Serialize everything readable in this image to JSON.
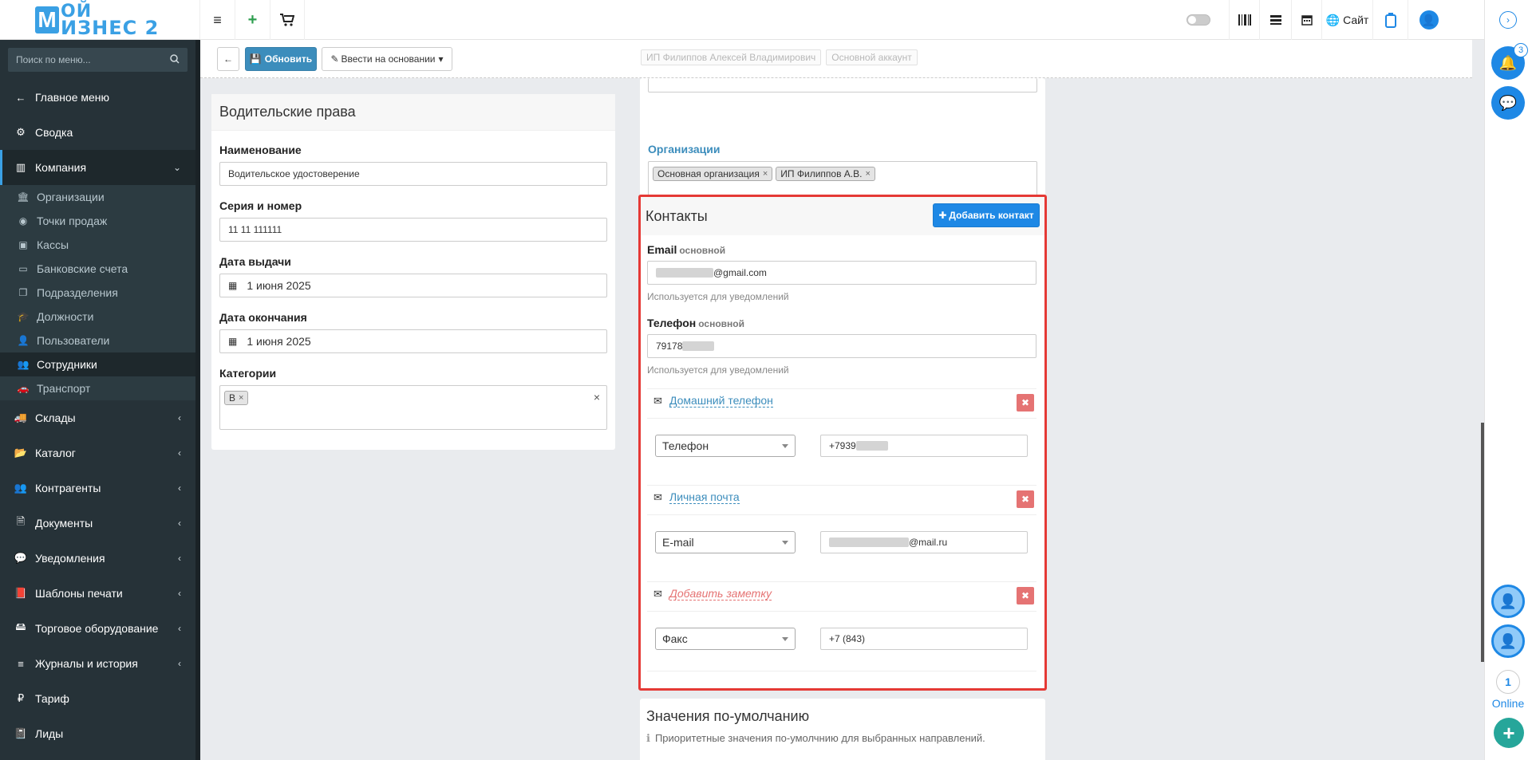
{
  "header": {
    "logo_top": "ОЙ",
    "logo_bottom": "ИЗНЕС 2",
    "site_label": "Сайт"
  },
  "sidebar": {
    "search_placeholder": "Поиск по меню...",
    "items": [
      {
        "label": "Главное меню"
      },
      {
        "label": "Сводка"
      },
      {
        "label": "Компания"
      },
      {
        "label": "Склады"
      },
      {
        "label": "Каталог"
      },
      {
        "label": "Контрагенты"
      },
      {
        "label": "Документы"
      },
      {
        "label": "Уведомления"
      },
      {
        "label": "Шаблоны печати"
      },
      {
        "label": "Торговое оборудование"
      },
      {
        "label": "Журналы и история"
      },
      {
        "label": "Тариф"
      },
      {
        "label": "Лиды"
      }
    ],
    "company_sub": [
      {
        "label": "Организации"
      },
      {
        "label": "Точки продаж"
      },
      {
        "label": "Кассы"
      },
      {
        "label": "Банковские счета"
      },
      {
        "label": "Подразделения"
      },
      {
        "label": "Должности"
      },
      {
        "label": "Пользователи"
      },
      {
        "label": "Сотрудники"
      },
      {
        "label": "Транспорт"
      }
    ]
  },
  "toolbar": {
    "refresh_label": "Обновить",
    "based_on_label": "Ввести на основании",
    "ghost_tag_1": "ИП Филиппов Алексей Владимирович",
    "ghost_tag_2": "Основной аккаунт"
  },
  "license": {
    "title": "Водительские права",
    "name_label": "Наименование",
    "name_value": "Водительское удостоверение",
    "series_label": "Серия и номер",
    "series_value": "11 11 111111",
    "issue_label": "Дата выдачи",
    "issue_value": "1 июня 2025",
    "expire_label": "Дата окончания",
    "expire_value": "1 июня 2025",
    "categories_label": "Категории",
    "category_tag": "B"
  },
  "orgs": {
    "label": "Организации",
    "tags": [
      "Основная организация",
      "ИП Филиппов А.В."
    ]
  },
  "contacts": {
    "title": "Контакты",
    "add_button": "Добавить контакт",
    "email_label": "Email",
    "email_sub": "основной",
    "email_value": "@gmail.com",
    "email_help": "Используется для уведомлений",
    "phone_label": "Телефон",
    "phone_sub": "основной",
    "phone_value": "79178",
    "phone_help": "Используется для уведомлений",
    "entries": [
      {
        "title": "Домашний телефон",
        "type": "Телефон",
        "value": "+7939"
      },
      {
        "title": "Личная почта",
        "type": "E-mail",
        "value": "@mail.ru"
      },
      {
        "title": "Добавить заметку",
        "type": "Факс",
        "value": "+7 (843)"
      }
    ]
  },
  "defaults": {
    "title": "Значения по-умолчанию",
    "hint": "Приоритетные значения по-умолчнию для выбранных направлений."
  },
  "rail": {
    "notif_count": "3",
    "online_count": "1",
    "online_label": "Online"
  }
}
